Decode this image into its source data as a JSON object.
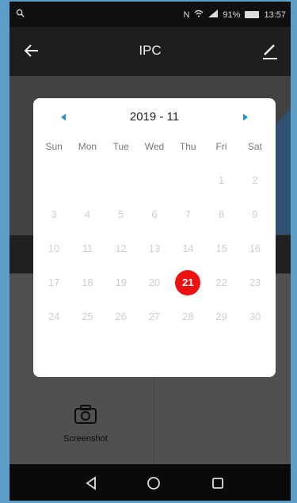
{
  "status_bar": {
    "battery": "91%",
    "time": "13:57"
  },
  "app_bar": {
    "title": "IPC"
  },
  "bottom": {
    "screenshot_label": "Screenshot"
  },
  "calendar": {
    "month_label": "2019 - 11",
    "weekdays": [
      "Sun",
      "Mon",
      "Tue",
      "Wed",
      "Thu",
      "Fri",
      "Sat"
    ],
    "days": [
      "",
      "",
      "",
      "",
      "",
      "1",
      "2",
      "3",
      "4",
      "5",
      "6",
      "7",
      "8",
      "9",
      "10",
      "11",
      "12",
      "13",
      "14",
      "15",
      "16",
      "17",
      "18",
      "19",
      "20",
      "21",
      "22",
      "23",
      "24",
      "25",
      "26",
      "27",
      "28",
      "29",
      "30"
    ],
    "selected_day": "21",
    "accent_color": "#ee1111",
    "arrow_color": "#2a8fd4"
  }
}
